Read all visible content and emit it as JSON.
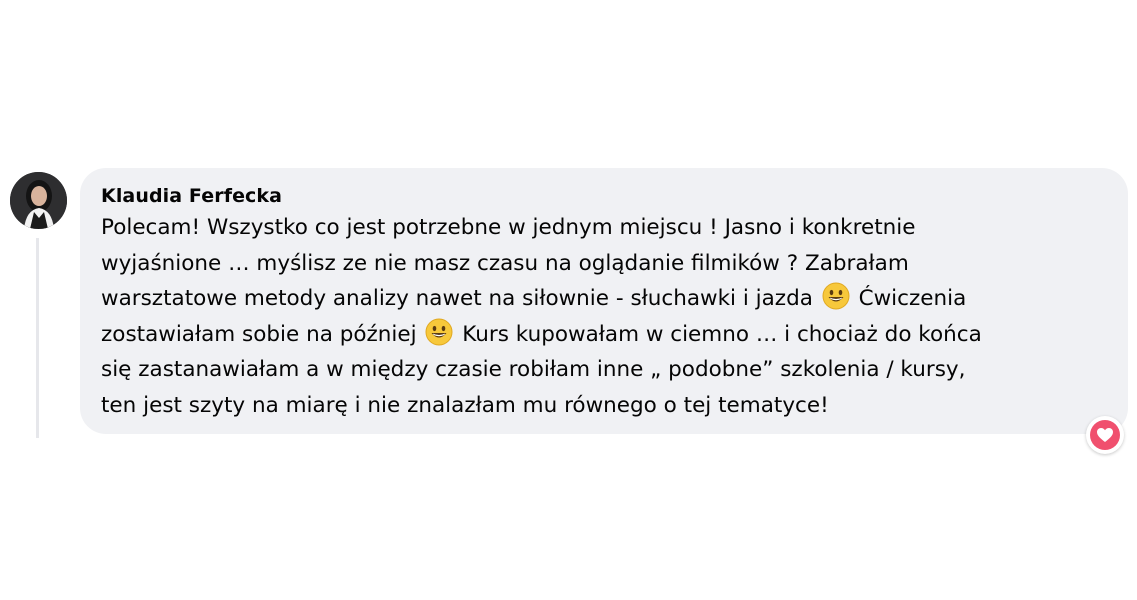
{
  "comment": {
    "author": "Klaudia Ferfecka",
    "text_lines": [
      {
        "parts": [
          "Polecam! Wszystko co jest potrzebne w jednym miejscu ! Jasno i konkretnie"
        ]
      },
      {
        "parts": [
          "wyjaśnione … myślisz ze nie masz czasu na oglądanie filmików ? Zabrałam"
        ]
      },
      {
        "parts": [
          "warsztatowe metody analizy nawet na siłownie - słuchawki i jazda ",
          " Ćwiczenia"
        ]
      },
      {
        "parts": [
          "zostawiałam sobie na później ",
          " Kurs kupowałam w ciemno … i chociaż do końca"
        ]
      },
      {
        "parts": [
          "się zastanawiałam a w między czasie robiłam inne „ podobne” szkolenia / kursy,"
        ]
      },
      {
        "parts": [
          "ten jest szyty na miarę i nie znalazłam mu równego o tej tematyce!"
        ]
      }
    ],
    "emoji_icon": "grinning-face-icon",
    "reaction_icon": "heart-reaction-icon"
  },
  "colors": {
    "bubble_background": "#f0f1f4",
    "text": "#050505",
    "heart": "#f0506e"
  }
}
